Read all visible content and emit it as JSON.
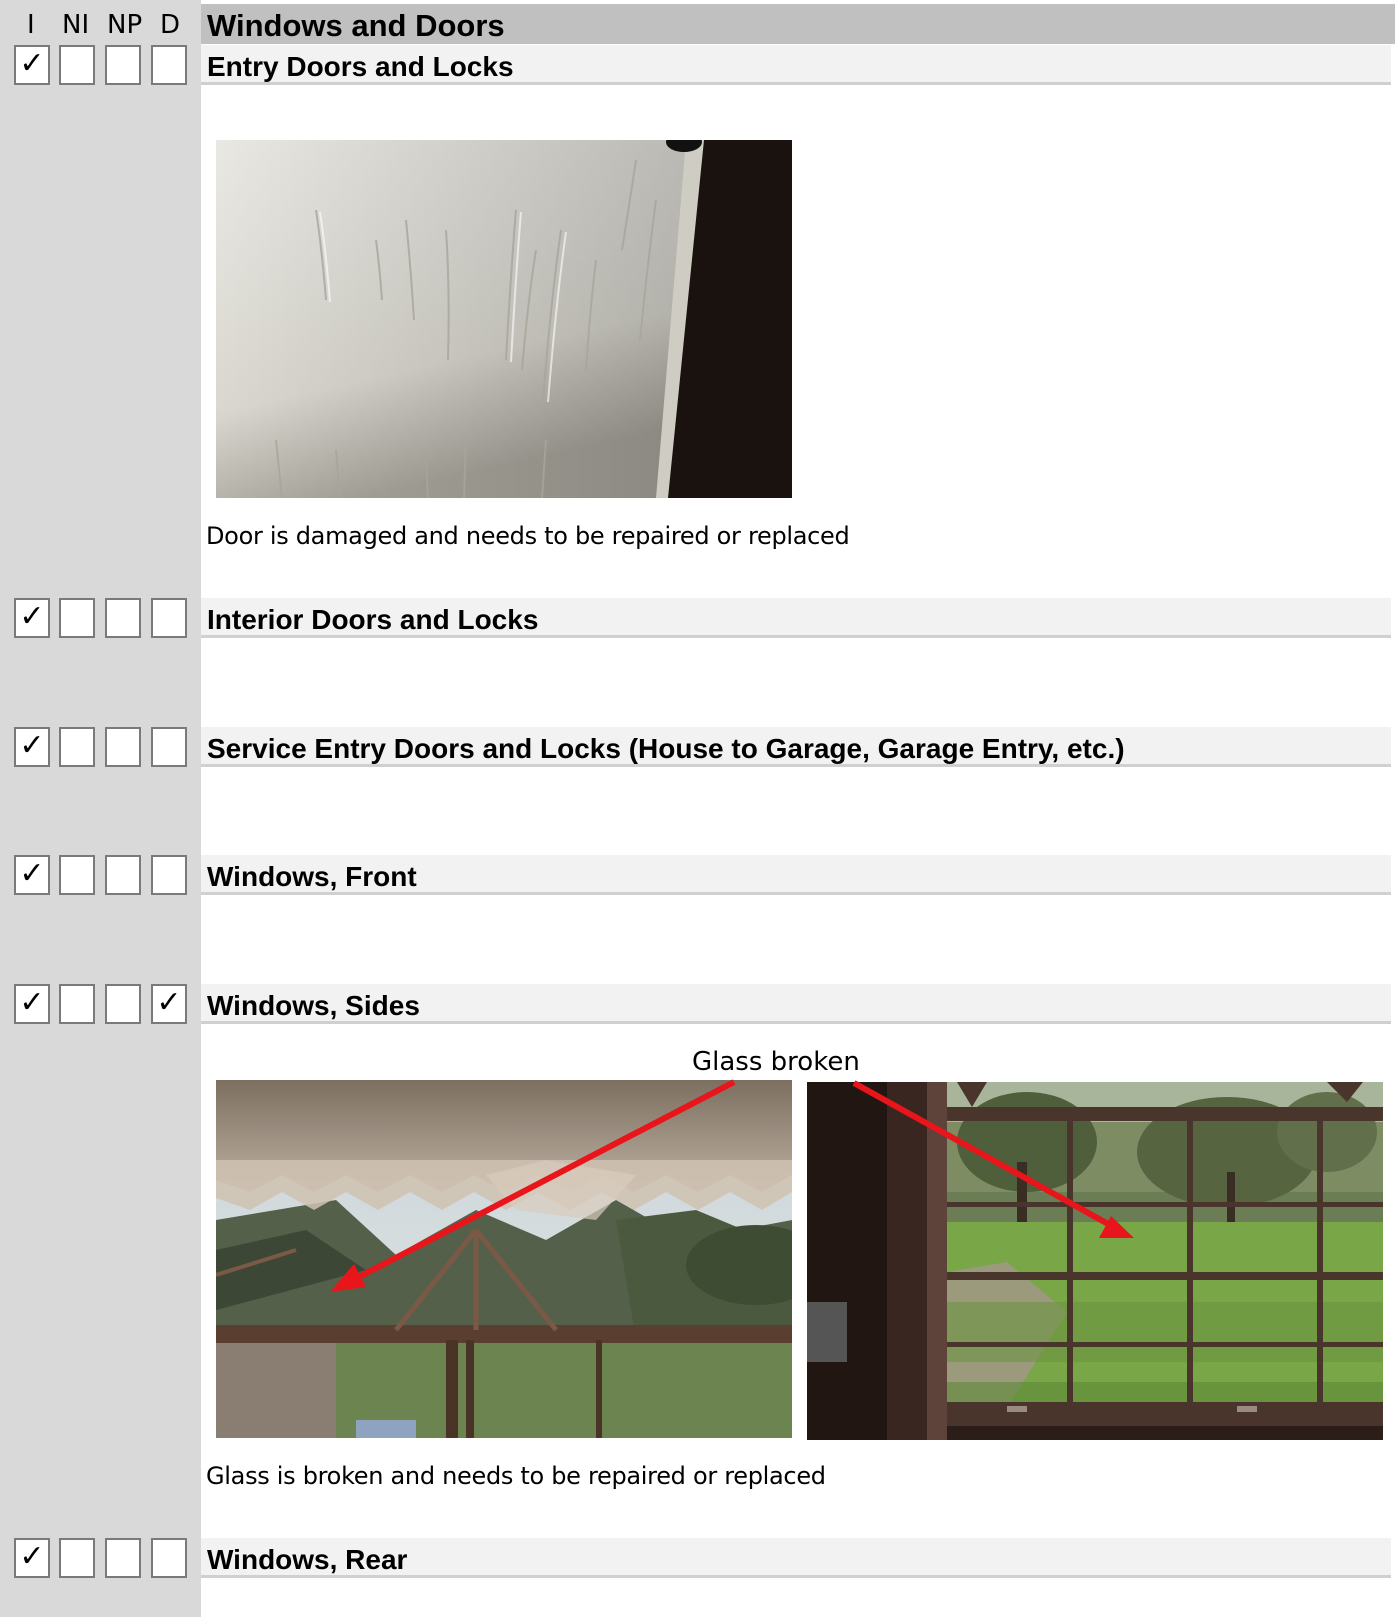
{
  "columns": {
    "inspected": "I",
    "not_inspected": "NI",
    "not_present": "NP",
    "deficient": "D"
  },
  "section": {
    "title": "Windows and Doors"
  },
  "check_glyph": "✓",
  "items": [
    {
      "title": "Entry Doors and Locks",
      "checks": {
        "I": true,
        "NI": false,
        "NP": false,
        "D": false
      }
    },
    {
      "title": "Interior Doors and Locks",
      "checks": {
        "I": true,
        "NI": false,
        "NP": false,
        "D": false
      }
    },
    {
      "title": "Service Entry Doors and Locks (House to Garage, Garage Entry, etc.)",
      "checks": {
        "I": true,
        "NI": false,
        "NP": false,
        "D": false
      }
    },
    {
      "title": "Windows, Front",
      "checks": {
        "I": true,
        "NI": false,
        "NP": false,
        "D": false
      }
    },
    {
      "title": "Windows, Sides",
      "checks": {
        "I": true,
        "NI": false,
        "NP": false,
        "D": true
      }
    },
    {
      "title": "Windows, Rear",
      "checks": {
        "I": true,
        "NI": false,
        "NP": false,
        "D": false
      }
    }
  ],
  "captions": {
    "entry_door": "Door is damaged and needs to be repaired or replaced",
    "windows_sides": "Glass is broken and needs to be repaired or replaced",
    "photo_label": "Glass broken"
  },
  "colors": {
    "arrow": "#e8151b",
    "gutter": "#d9d9d9",
    "section_bar": "#c0c0c0",
    "item_bar": "#f2f2f2"
  }
}
